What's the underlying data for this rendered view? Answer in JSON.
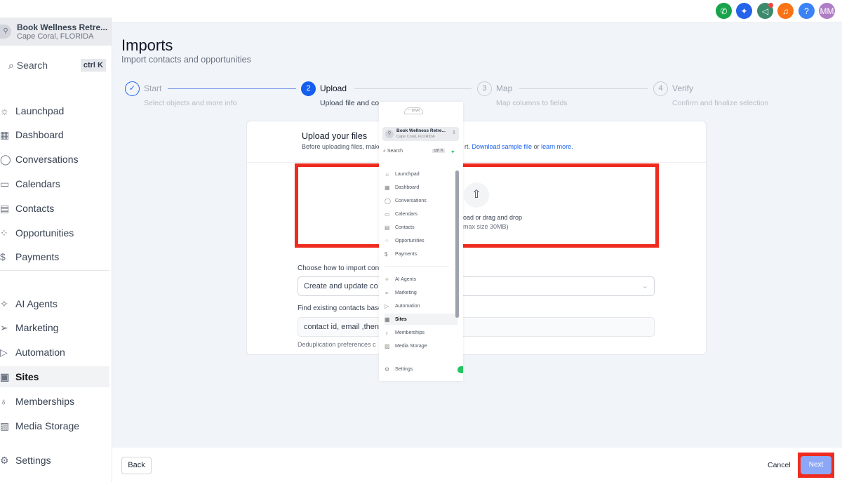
{
  "topbar": {
    "icons": [
      {
        "name": "phone-icon",
        "color": "#16a34a",
        "glyph": "✆"
      },
      {
        "name": "sparkle-icon",
        "color": "#2563eb",
        "glyph": "✦"
      },
      {
        "name": "megaphone-icon",
        "color": "#3b8a6b",
        "glyph": "📢"
      },
      {
        "name": "bell-icon",
        "color": "#f97316",
        "glyph": "🔔"
      },
      {
        "name": "help-icon",
        "color": "#3b82f6",
        "glyph": "?"
      }
    ],
    "avatar": "MM",
    "avatar_color": "#b07cc6"
  },
  "sidebar": {
    "location_name": "Book Wellness Retre...",
    "location_city": "Cape Coral, FLORIDA",
    "search": "Search",
    "shortcut": "ctrl K",
    "items": [
      {
        "label": "Launchpad",
        "icon": "☼"
      },
      {
        "label": "Dashboard",
        "icon": "▦"
      },
      {
        "label": "Conversations",
        "icon": "◯"
      },
      {
        "label": "Calendars",
        "icon": "▭"
      },
      {
        "label": "Contacts",
        "icon": "▤"
      },
      {
        "label": "Opportunities",
        "icon": "⁘"
      },
      {
        "label": "Payments",
        "icon": "$"
      },
      {
        "label": "AI Agents",
        "icon": "✧"
      },
      {
        "label": "Marketing",
        "icon": "➢"
      },
      {
        "label": "Automation",
        "icon": "▷"
      },
      {
        "label": "Sites",
        "icon": "▣"
      },
      {
        "label": "Memberships",
        "icon": "♁"
      },
      {
        "label": "Media Storage",
        "icon": "▨"
      }
    ],
    "settings": "Settings",
    "active": "Sites"
  },
  "page": {
    "title": "Imports",
    "subtitle": "Import contacts and opportunities"
  },
  "steps": [
    {
      "num": "✓",
      "label": "Start",
      "desc": "Select objects and more info"
    },
    {
      "num": "2",
      "label": "Upload",
      "desc": "Upload file and co"
    },
    {
      "num": "3",
      "label": "Map",
      "desc": "Map columns to fields"
    },
    {
      "num": "4",
      "label": "Verify",
      "desc": "Confirm and finalize selection"
    }
  ],
  "card": {
    "title": "Upload your files",
    "desc_before": "Before uploading files, make",
    "desc_after": "rt.",
    "download_link": "Download sample file",
    "or": "or",
    "learn_link": "learn more.",
    "drop_text": "oad or drag and drop",
    "drop_hint": "max size 30MB)",
    "import_label": "Choose how to import contac",
    "import_value": "Create and update co",
    "find_label": "Find existing contacts based",
    "find_value": "contact id, email ,then",
    "dedup_note": "Deduplication preferences c"
  },
  "popup": {
    "location_name": "Book Wellness Retre...",
    "location_city": "Cape Coral, FLORIDA",
    "search": "Search",
    "shortcut": "ctrl K",
    "settings": "Settings"
  },
  "footer": {
    "back": "Back",
    "cancel": "Cancel",
    "next": "Next"
  },
  "colors": {
    "accent": "#155eef",
    "highlight": "#ef2b1f",
    "next_bg": "#8ca7f7"
  }
}
